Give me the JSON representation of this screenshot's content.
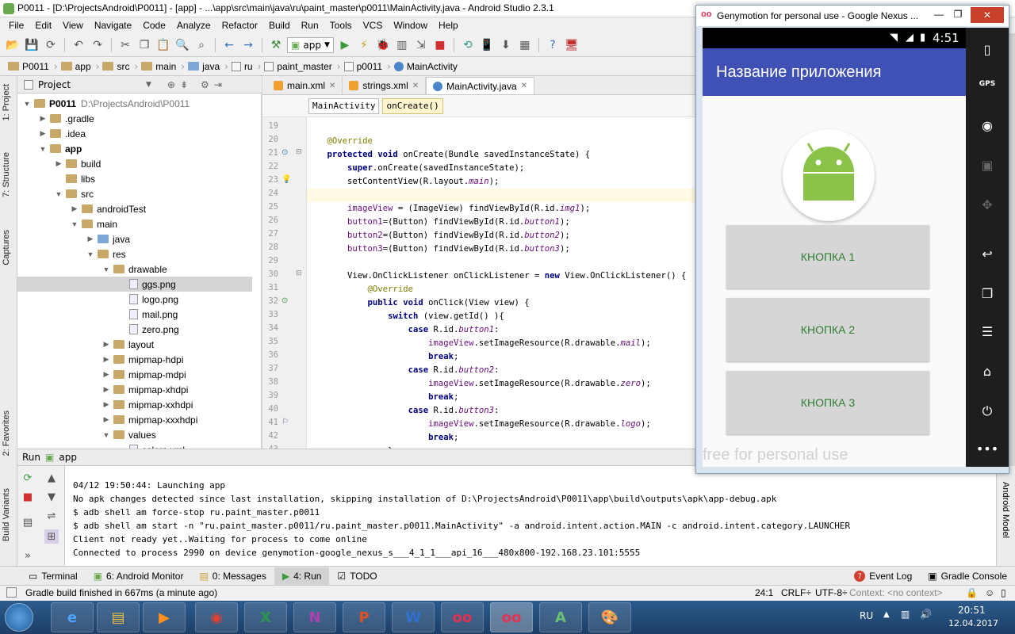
{
  "window": {
    "title": "P0011 - [D:\\ProjectsAndroid\\P0011] - [app] - ...\\app\\src\\main\\java\\ru\\paint_master\\p0011\\MainActivity.java - Android Studio 2.3.1",
    "minimize": "—",
    "maximize": "❐",
    "close": "✕"
  },
  "menu": [
    "File",
    "Edit",
    "View",
    "Navigate",
    "Code",
    "Analyze",
    "Refactor",
    "Build",
    "Run",
    "Tools",
    "VCS",
    "Window",
    "Help"
  ],
  "toolbar": {
    "run_config": "app"
  },
  "breadcrumbs": [
    "P0011",
    "app",
    "src",
    "main",
    "java",
    "ru",
    "paint_master",
    "p0011",
    "MainActivity"
  ],
  "left_tabs": {
    "project": "1: Project",
    "structure": "7: Structure",
    "captures": "Captures",
    "favorites": "2: Favorites",
    "build_variants": "Build Variants"
  },
  "project_panel": {
    "title": "Project",
    "tree": [
      {
        "label": "P0011",
        "extra": "D:\\ProjectsAndroid\\P0011",
        "depth": 0,
        "arrow": "▼",
        "icon": "folder",
        "bold": true
      },
      {
        "label": ".gradle",
        "depth": 1,
        "arrow": "▶",
        "icon": "folder"
      },
      {
        "label": ".idea",
        "depth": 1,
        "arrow": "▶",
        "icon": "folder"
      },
      {
        "label": "app",
        "depth": 1,
        "arrow": "▼",
        "icon": "folder",
        "bold": true
      },
      {
        "label": "build",
        "depth": 2,
        "arrow": "▶",
        "icon": "folder"
      },
      {
        "label": "libs",
        "depth": 2,
        "arrow": "",
        "icon": "folder"
      },
      {
        "label": "src",
        "depth": 2,
        "arrow": "▼",
        "icon": "folder"
      },
      {
        "label": "androidTest",
        "depth": 3,
        "arrow": "▶",
        "icon": "folder"
      },
      {
        "label": "main",
        "depth": 3,
        "arrow": "▼",
        "icon": "folder"
      },
      {
        "label": "java",
        "depth": 4,
        "arrow": "▶",
        "icon": "folder-blue"
      },
      {
        "label": "res",
        "depth": 4,
        "arrow": "▼",
        "icon": "folder"
      },
      {
        "label": "drawable",
        "depth": 5,
        "arrow": "▼",
        "icon": "folder"
      },
      {
        "label": "ggs.png",
        "depth": 6,
        "arrow": "",
        "icon": "file",
        "selected": true
      },
      {
        "label": "logo.png",
        "depth": 6,
        "arrow": "",
        "icon": "file"
      },
      {
        "label": "mail.png",
        "depth": 6,
        "arrow": "",
        "icon": "file"
      },
      {
        "label": "zero.png",
        "depth": 6,
        "arrow": "",
        "icon": "file"
      },
      {
        "label": "layout",
        "depth": 5,
        "arrow": "▶",
        "icon": "folder"
      },
      {
        "label": "mipmap-hdpi",
        "depth": 5,
        "arrow": "▶",
        "icon": "folder"
      },
      {
        "label": "mipmap-mdpi",
        "depth": 5,
        "arrow": "▶",
        "icon": "folder"
      },
      {
        "label": "mipmap-xhdpi",
        "depth": 5,
        "arrow": "▶",
        "icon": "folder"
      },
      {
        "label": "mipmap-xxhdpi",
        "depth": 5,
        "arrow": "▶",
        "icon": "folder"
      },
      {
        "label": "mipmap-xxxhdpi",
        "depth": 5,
        "arrow": "▶",
        "icon": "folder"
      },
      {
        "label": "values",
        "depth": 5,
        "arrow": "▼",
        "icon": "folder"
      },
      {
        "label": "colors.xml",
        "depth": 6,
        "arrow": "",
        "icon": "file"
      }
    ]
  },
  "editor": {
    "tabs": [
      {
        "label": "main.xml",
        "icon": "xml",
        "active": false
      },
      {
        "label": "strings.xml",
        "icon": "xml",
        "active": false
      },
      {
        "label": "MainActivity.java",
        "icon": "java",
        "active": true
      }
    ],
    "crumbs": [
      "MainActivity",
      "onCreate()"
    ],
    "lines": [
      {
        "n": "19",
        "html": ""
      },
      {
        "n": "20",
        "html": "    <span class=\"ann\">@Override</span>"
      },
      {
        "n": "21",
        "html": "    <span class=\"kw\">protected void</span> onCreate(Bundle savedInstanceState) {"
      },
      {
        "n": "22",
        "html": "        <span class=\"kw\">super</span>.onCreate(savedInstanceState);"
      },
      {
        "n": "23",
        "html": "        setContentView(R.layout.<span class=\"fld\">main</span>);"
      },
      {
        "n": "24",
        "html": "",
        "cur": true
      },
      {
        "n": "25",
        "html": "        <span class=\"fld\" style=\"font-style:normal\">imageView</span> = (ImageView) findViewById(R.id.<span class=\"fld\">img1</span>);"
      },
      {
        "n": "26",
        "html": "        <span class=\"fld\" style=\"font-style:normal\">button1</span>=(Button) findViewById(R.id.<span class=\"fld\">button1</span>);"
      },
      {
        "n": "27",
        "html": "        <span class=\"fld\" style=\"font-style:normal\">button2</span>=(Button) findViewById(R.id.<span class=\"fld\">button2</span>);"
      },
      {
        "n": "28",
        "html": "        <span class=\"fld\" style=\"font-style:normal\">button3</span>=(Button) findViewById(R.id.<span class=\"fld\">button3</span>);"
      },
      {
        "n": "29",
        "html": ""
      },
      {
        "n": "30",
        "html": "        View.OnClickListener onClickListener = <span class=\"kw\">new</span> View.OnClickListener() {"
      },
      {
        "n": "31",
        "html": "            <span class=\"ann\">@Override</span>"
      },
      {
        "n": "32",
        "html": "            <span class=\"kw\">public void</span> onClick(View view) {"
      },
      {
        "n": "33",
        "html": "                <span class=\"kw\">switch</span> (view.getId() ){"
      },
      {
        "n": "34",
        "html": "                    <span class=\"kw\">case</span> R.id.<span class=\"fld\">button1</span>:"
      },
      {
        "n": "35",
        "html": "                        <span class=\"fld\" style=\"font-style:normal\">imageView</span>.setImageResource(R.drawable.<span class=\"fld\">mail</span>);"
      },
      {
        "n": "36",
        "html": "                        <span class=\"kw\">break</span>;"
      },
      {
        "n": "37",
        "html": "                    <span class=\"kw\">case</span> R.id.<span class=\"fld\">button2</span>:"
      },
      {
        "n": "38",
        "html": "                        <span class=\"fld\" style=\"font-style:normal\">imageView</span>.setImageResource(R.drawable.<span class=\"fld\">zero</span>);"
      },
      {
        "n": "39",
        "html": "                        <span class=\"kw\">break</span>;"
      },
      {
        "n": "40",
        "html": "                    <span class=\"kw\">case</span> R.id.<span class=\"fld\">button3</span>:"
      },
      {
        "n": "41",
        "html": "                        <span class=\"fld\" style=\"font-style:normal\">imageView</span>.setImageResource(R.drawable.<span class=\"fld\">logo</span>);"
      },
      {
        "n": "42",
        "html": "                        <span class=\"kw\">break</span>;"
      },
      {
        "n": "43",
        "html": "                }"
      }
    ]
  },
  "run": {
    "label": "Run",
    "config": "app",
    "console": [
      "04/12 19:50:44: Launching app",
      "No apk changes detected since last installation, skipping installation of D:\\ProjectsAndroid\\P0011\\app\\build\\outputs\\apk\\app-debug.apk",
      "$ adb shell am force-stop ru.paint_master.p0011",
      "$ adb shell am start -n \"ru.paint_master.p0011/ru.paint_master.p0011.MainActivity\" -a android.intent.action.MAIN -c android.intent.category.LAUNCHER",
      "Client not ready yet..Waiting for process to come online",
      "Connected to process 2990 on device genymotion-google_nexus_s___4_1_1___api_16___480x800-192.168.23.101:5555"
    ],
    "right_tab": "Android Model"
  },
  "bottom_tabs": {
    "terminal": "Terminal",
    "monitor": "6: Android Monitor",
    "messages": "0: Messages",
    "run": "4: Run",
    "todo": "TODO",
    "event_log": "Event Log",
    "event_count": "7",
    "gradle": "Gradle Console"
  },
  "status": {
    "message": "Gradle build finished in 667ms (a minute ago)",
    "position": "24:1",
    "line_sep": "CRLF÷",
    "encoding": "UTF-8÷",
    "context": "Context: <no context>"
  },
  "genymotion": {
    "title": "Genymotion for personal use - Google Nexus ...",
    "time": "4:51",
    "app_title": "Название приложения",
    "buttons": [
      "КНОПКА 1",
      "КНОПКА 2",
      "КНОПКА 3"
    ],
    "watermark": "free for personal use",
    "gps": "GPS"
  },
  "taskbar": {
    "lang": "RU",
    "time": "20:51",
    "date": "12.04.2017"
  }
}
